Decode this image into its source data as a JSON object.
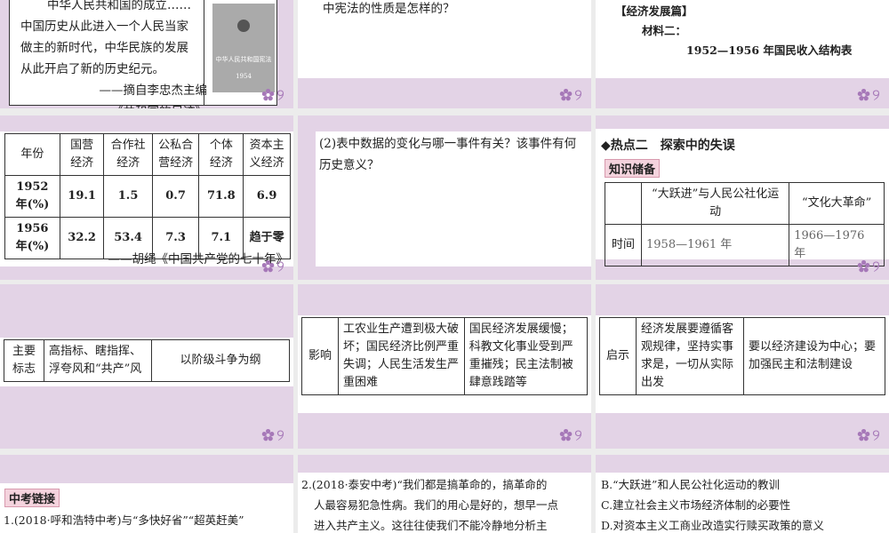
{
  "slide1": {
    "lines": [
      "中华人民共和国的成立……",
      "中国历史从此进入一个人民当家",
      "做主的新时代，中华民族的发展",
      "从此开启了新的历史纪元。"
    ],
    "source1": "——摘自李忠杰主编",
    "source2": "《共和国的足迹》",
    "book_title": "中华人民共和国宪法",
    "book_year": "1954"
  },
  "slide2": {
    "text": "中宪法的性质是怎样的？"
  },
  "slide3": {
    "section": "【经济发展篇】",
    "material": "材料二：",
    "caption": "1952—1956 年国民收入结构表"
  },
  "slide4": {
    "headers": [
      "年份",
      "国营经济",
      "合作社经济",
      "公私合营经济",
      "个体经济",
      "资本主义经济"
    ],
    "rows": [
      [
        "1952 年(%)",
        "19.1",
        "1.5",
        "0.7",
        "71.8",
        "6.9"
      ],
      [
        "1956 年(%)",
        "32.2",
        "53.4",
        "7.3",
        "7.1",
        "趋于零"
      ]
    ],
    "source": "——胡绳《中国共产党的七十年》"
  },
  "slide5": {
    "text": "(2)表中数据的变化与哪一事件有关？该事件有何历史意义？"
  },
  "slide6": {
    "heading": "◆热点二　探索中的失误",
    "tag": "知识储备",
    "col1": "“大跃进”与人民公社化运动",
    "col2": "“文化大革命”",
    "row_label": "时间",
    "time1": "1958—1961 年",
    "time2": "1966—1976 年"
  },
  "slide7": {
    "label": "主要标志",
    "v1": "高指标、瞎指挥、浮夸风和“共产”风",
    "v2": "以阶级斗争为纲"
  },
  "slide8": {
    "label": "影响",
    "v1": "工农业生产遭到极大破坏；国民经济比例严重失调；人民生活发生严重困难",
    "v2": "国民经济发展缓慢；科教文化事业受到严重摧残；民主法制被肆意践踏等"
  },
  "slide9": {
    "label": "启示",
    "v1": "经济发展要遵循客观规律，坚持实事求是，一切从实际出发",
    "v2": "要以经济建设为中心；要加强民主和法制建设"
  },
  "slide10": {
    "tag": "中考链接",
    "q1": "1.(2018·呼和浩特中考)与“多快好省”“超英赶美”"
  },
  "slide11": {
    "lines": [
      "2.(2018·泰安中考)“我们都是搞革命的，搞革命的",
      "人最容易犯急性病。我们的用心是好的，想早一点",
      "进入共产主义。这往往使我们不能冷静地分析主"
    ]
  },
  "slide12": {
    "options": [
      "B.“大跃进”和人民公社化运动的教训",
      "C.建立社会主义市场经济体制的必要性",
      "D.对资本主义工商业改造实行赎买政策的意义"
    ]
  }
}
